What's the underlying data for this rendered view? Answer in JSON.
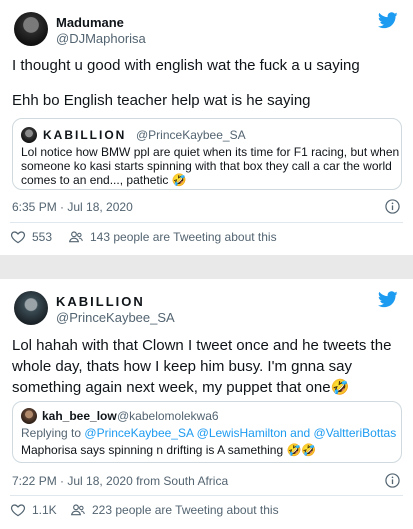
{
  "colors": {
    "blue": "#1d9bf0",
    "muted": "#536471",
    "border": "#cfd9de"
  },
  "tweet1": {
    "name": "Madumane",
    "handle": "@DJMaphorisa",
    "line1": "I thought u good with english wat the fuck a u saying",
    "line2": "Ehh bo English teacher help wat is he saying",
    "quote": {
      "name": "KABILLION",
      "handle": "@PrinceKaybee_SA",
      "text_l1": "Lol notice how BMW ppl are quiet when its time for F1 racing, but when",
      "text_l2": "someone ko kasi starts spinning with that box they call a car the world",
      "text_l3": "comes to an end..., pathetic 🤣"
    },
    "timestamp": "6:35 PM · Jul 18, 2020",
    "likes": "553",
    "tweeting": "143 people are Tweeting about this"
  },
  "tweet2": {
    "name": "KABILLION",
    "handle": "@PrinceKaybee_SA",
    "text_l1": "Lol hahah with that Clown I tweet once and he tweets the",
    "text_l2": "whole day, thats how I keep him busy. I'm gnna say",
    "text_l3": "something again next week, my puppet that one🤣",
    "quote": {
      "name": "kah_bee_low",
      "handle": "@kabelomolekwa6",
      "reply_prefix": "Replying to",
      "reply_mentions": "@PrinceKaybee_SA @LewisHamilton and @ValtteriBottas",
      "text": "Maphorisa says spinning n drifting is A samething 🤣🤣"
    },
    "timestamp": "7:22 PM · Jul 18, 2020 from South Africa",
    "likes": "1.1K",
    "tweeting": "223 people are Tweeting about this"
  },
  "icons": {
    "bird": "twitter-bird-icon",
    "info": "info-icon",
    "heart": "heart-icon",
    "people": "people-icon"
  }
}
